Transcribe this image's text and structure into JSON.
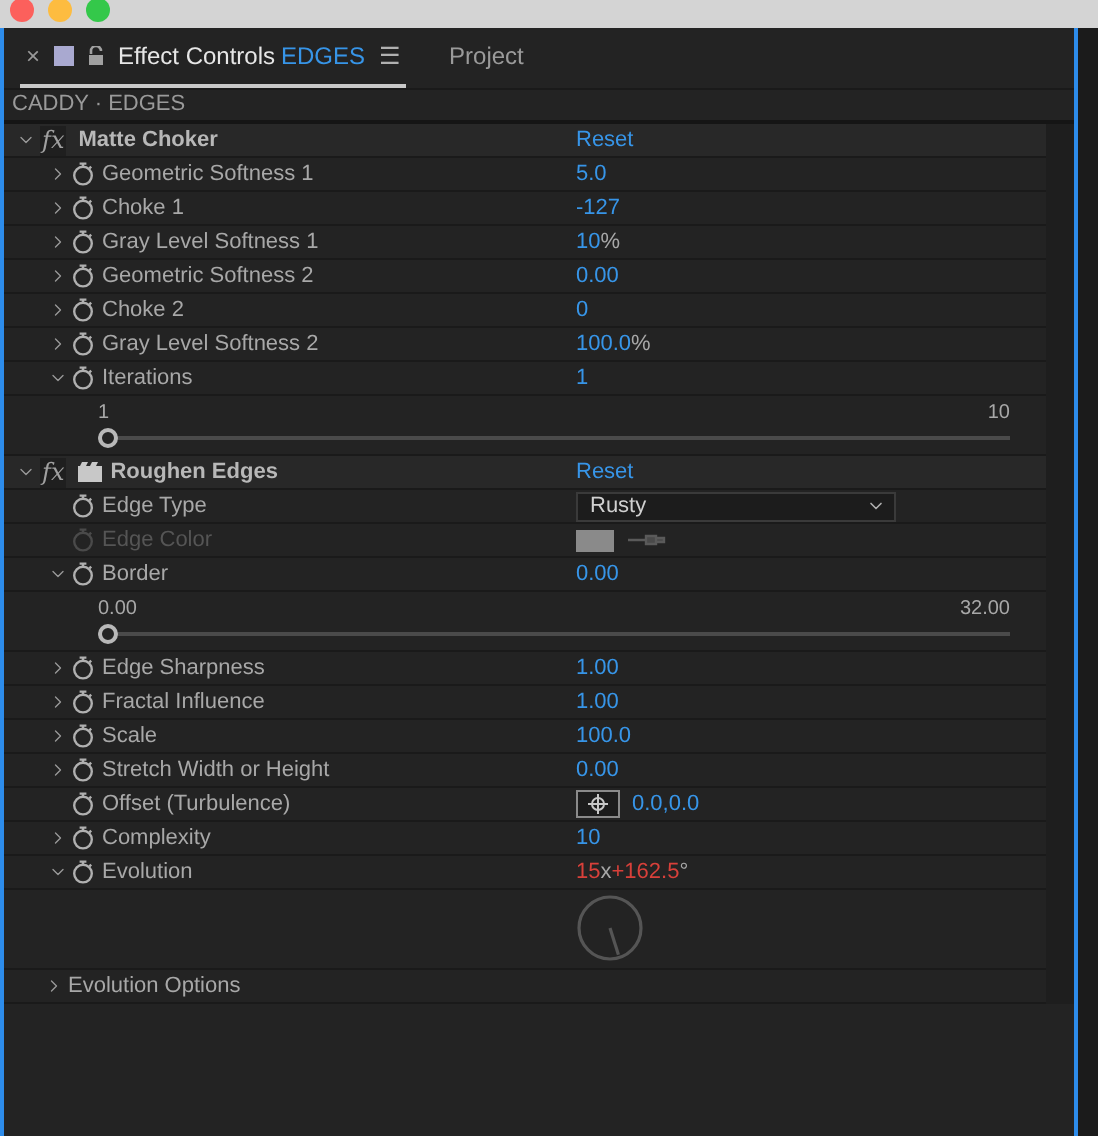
{
  "tabs": [
    {
      "kind": "panel",
      "close": "×",
      "title": "Effect Controls",
      "subject": "EDGES",
      "menu": "☰",
      "selected": true
    },
    {
      "kind": "plain",
      "title": "Project",
      "selected": false
    }
  ],
  "layer_path": "CADDY · EDGES",
  "effects": [
    {
      "badge": "fx",
      "name": "Matte Choker",
      "reset": "Reset",
      "expanded": true,
      "preset_icon": false,
      "properties": [
        {
          "kind": "number",
          "label": "Geometric Softness 1",
          "value": "5.0",
          "expanded": false
        },
        {
          "kind": "number",
          "label": "Choke 1",
          "value": "-127",
          "expanded": false
        },
        {
          "kind": "number",
          "label": "Gray Level Softness 1",
          "value": "10",
          "unit": "%",
          "expanded": false
        },
        {
          "kind": "number",
          "label": "Geometric Softness 2",
          "value": "0.00",
          "expanded": false
        },
        {
          "kind": "number",
          "label": "Choke 2",
          "value": "0",
          "expanded": false
        },
        {
          "kind": "number",
          "label": "Gray Level Softness 2",
          "value": "100.0",
          "unit": "%",
          "expanded": false
        },
        {
          "kind": "number",
          "label": "Iterations",
          "value": "1",
          "expanded": true,
          "slider": {
            "min": "1",
            "max": "10",
            "level": 0
          }
        }
      ]
    },
    {
      "badge": "fx",
      "name": "Roughen Edges",
      "reset": "Reset",
      "expanded": true,
      "preset_icon": true,
      "properties": [
        {
          "kind": "dropdown",
          "label": "Edge Type",
          "value": "Rusty"
        },
        {
          "kind": "color",
          "label": "Edge Color",
          "disabled": true,
          "color": "#8a8a8a"
        },
        {
          "kind": "number",
          "label": "Border",
          "value": "0.00",
          "expanded": true,
          "slider": {
            "min": "0.00",
            "max": "32.00",
            "level": 0
          }
        },
        {
          "kind": "number",
          "label": "Edge Sharpness",
          "value": "1.00",
          "expanded": false
        },
        {
          "kind": "number",
          "label": "Fractal Influence",
          "value": "1.00",
          "expanded": false
        },
        {
          "kind": "number",
          "label": "Scale",
          "value": "100.0",
          "expanded": false
        },
        {
          "kind": "number",
          "label": "Stretch Width or Height",
          "value": "0.00",
          "expanded": false
        },
        {
          "kind": "point",
          "label": "Offset (Turbulence)",
          "value": "0.0,0.0"
        },
        {
          "kind": "number",
          "label": "Complexity",
          "value": "10",
          "expanded": false
        },
        {
          "kind": "angle",
          "label": "Evolution",
          "revolutions": "15",
          "times": "x",
          "degrees": "+162.5",
          "unit": "°",
          "expanded": true
        },
        {
          "kind": "group",
          "label": "Evolution Options",
          "expanded": false
        }
      ]
    }
  ]
}
